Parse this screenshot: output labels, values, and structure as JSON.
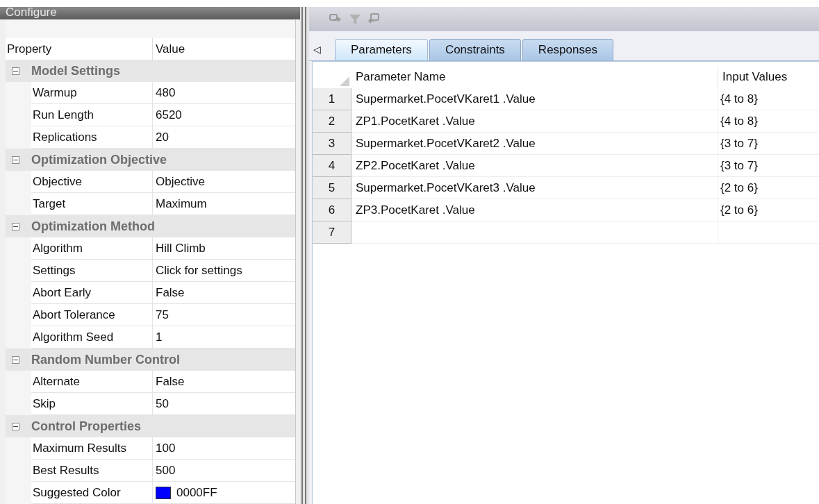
{
  "panel": {
    "title": "Configure",
    "columns": [
      "Property",
      "Value"
    ],
    "categories": [
      {
        "name": "Model Settings",
        "expanded": true,
        "properties": [
          {
            "name": "Warmup",
            "value": "480"
          },
          {
            "name": "Run Length",
            "value": "6520"
          },
          {
            "name": "Replications",
            "value": "20"
          }
        ]
      },
      {
        "name": "Optimization Objective",
        "expanded": true,
        "properties": [
          {
            "name": "Objective",
            "value": "Objective"
          },
          {
            "name": "Target",
            "value": "Maximum"
          }
        ]
      },
      {
        "name": "Optimization Method",
        "expanded": true,
        "properties": [
          {
            "name": "Algorithm",
            "value": "Hill Climb"
          },
          {
            "name": "Settings",
            "value": "Click for settings"
          },
          {
            "name": "Abort Early",
            "value": "False"
          },
          {
            "name": "Abort Tolerance",
            "value": "75"
          },
          {
            "name": "Algorithm Seed",
            "value": "1"
          }
        ]
      },
      {
        "name": "Random Number Control",
        "expanded": true,
        "properties": [
          {
            "name": "Alternate",
            "value": "False"
          },
          {
            "name": "Skip",
            "value": "50"
          }
        ]
      },
      {
        "name": "Control Properties",
        "expanded": true,
        "properties": [
          {
            "name": "Maximum Results",
            "value": "100"
          },
          {
            "name": "Best Results",
            "value": "500"
          },
          {
            "name": "Suggested Color",
            "value": "0000FF",
            "color": "#0000ff"
          }
        ]
      }
    ]
  },
  "tab_scroll": "◁",
  "tabs": [
    {
      "label": "Parameters",
      "selected": true
    },
    {
      "label": "Constraints",
      "selected": false
    },
    {
      "label": "Responses",
      "selected": false
    }
  ],
  "grid": {
    "columns": [
      "Parameter Name",
      "Input Values"
    ],
    "rows": [
      {
        "number": "1",
        "name": "Supermarket.PocetVKaret1 .Value",
        "values": "{4 to 8}"
      },
      {
        "number": "2",
        "name": "ZP1.PocetKaret .Value",
        "values": "{4 to 8}"
      },
      {
        "number": "3",
        "name": "Supermarket.PocetVKaret2 .Value",
        "values": "{3 to 7}"
      },
      {
        "number": "4",
        "name": "ZP2.PocetKaret .Value",
        "values": "{3 to 7}"
      },
      {
        "number": "5",
        "name": "Supermarket.PocetVKaret3 .Value",
        "values": "{2 to 6}"
      },
      {
        "number": "6",
        "name": "ZP3.PocetKaret .Value",
        "values": "{2 to 6}"
      },
      {
        "number": "7"
      }
    ]
  }
}
